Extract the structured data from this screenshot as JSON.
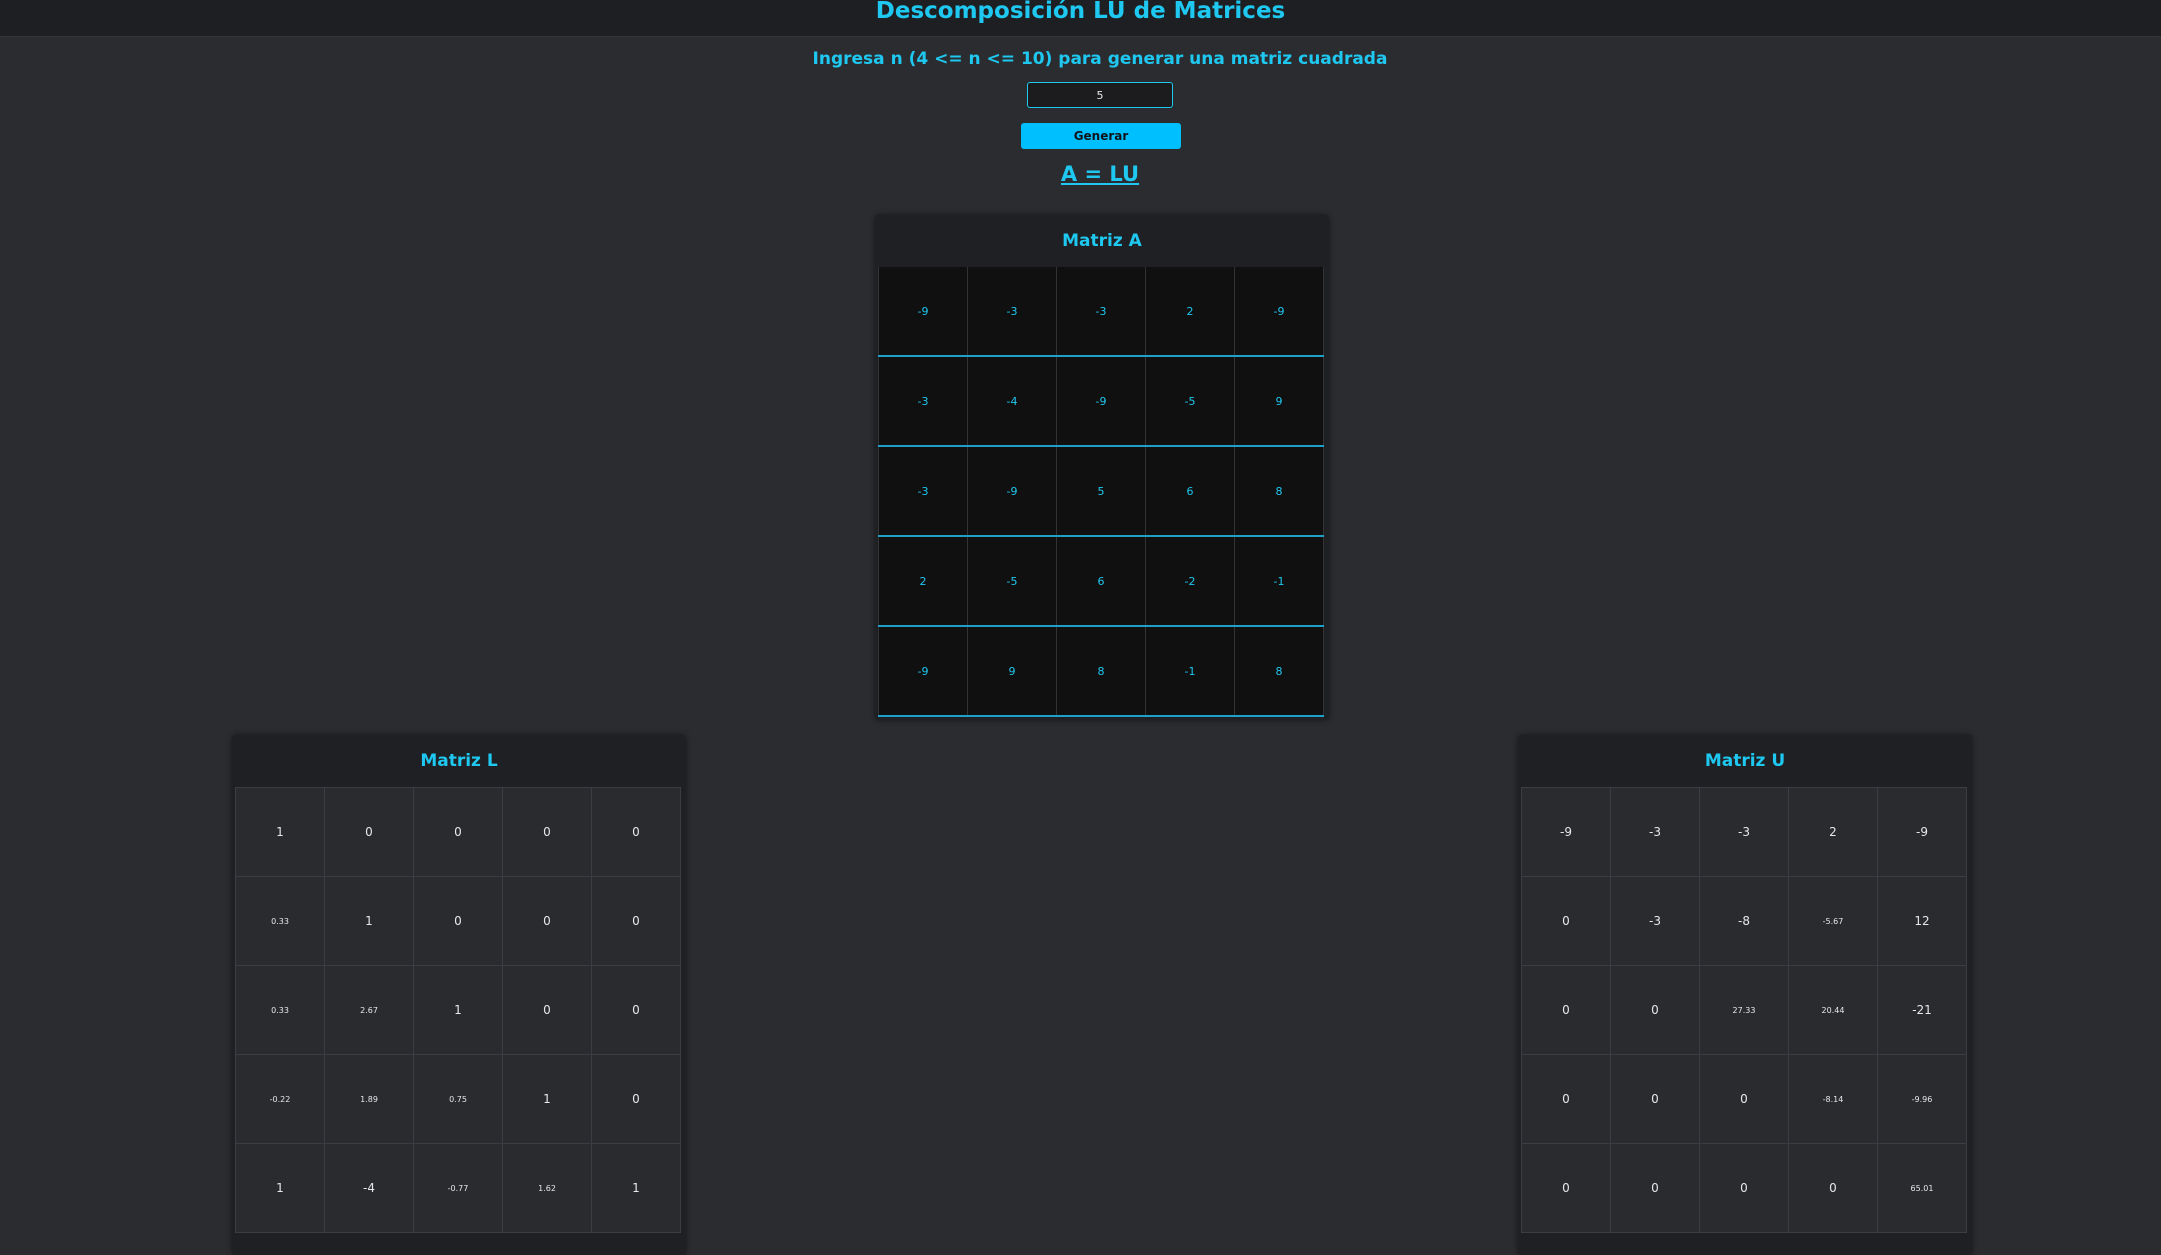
{
  "header": {
    "title": "Descomposición LU de Matrices"
  },
  "form": {
    "prompt": "Ingresa n (4 <= n <= 10) para generar una matriz cuadrada",
    "n_value": "5",
    "generate_label": "Generar"
  },
  "equation": "A = LU",
  "matrix_a": {
    "title": "Matriz A",
    "rows": [
      [
        "-9",
        "-3",
        "-3",
        "2",
        "-9"
      ],
      [
        "-3",
        "-4",
        "-9",
        "-5",
        "9"
      ],
      [
        "-3",
        "-9",
        "5",
        "6",
        "8"
      ],
      [
        "2",
        "-5",
        "6",
        "-2",
        "-1"
      ],
      [
        "-9",
        "9",
        "8",
        "-1",
        "8"
      ]
    ]
  },
  "matrix_l": {
    "title": "Matriz L",
    "rows": [
      [
        "1",
        "0",
        "0",
        "0",
        "0"
      ],
      [
        "0.33",
        "1",
        "0",
        "0",
        "0"
      ],
      [
        "0.33",
        "2.67",
        "1",
        "0",
        "0"
      ],
      [
        "-0.22",
        "1.89",
        "0.75",
        "1",
        "0"
      ],
      [
        "1",
        "-4",
        "-0.77",
        "1.62",
        "1"
      ]
    ]
  },
  "matrix_u": {
    "title": "Matriz U",
    "rows": [
      [
        "-9",
        "-3",
        "-3",
        "2",
        "-9"
      ],
      [
        "0",
        "-3",
        "-8",
        "-5.67",
        "12"
      ],
      [
        "0",
        "0",
        "27.33",
        "20.44",
        "-21"
      ],
      [
        "0",
        "0",
        "0",
        "-8.14",
        "-9.96"
      ],
      [
        "0",
        "0",
        "0",
        "0",
        "65.01"
      ]
    ]
  }
}
